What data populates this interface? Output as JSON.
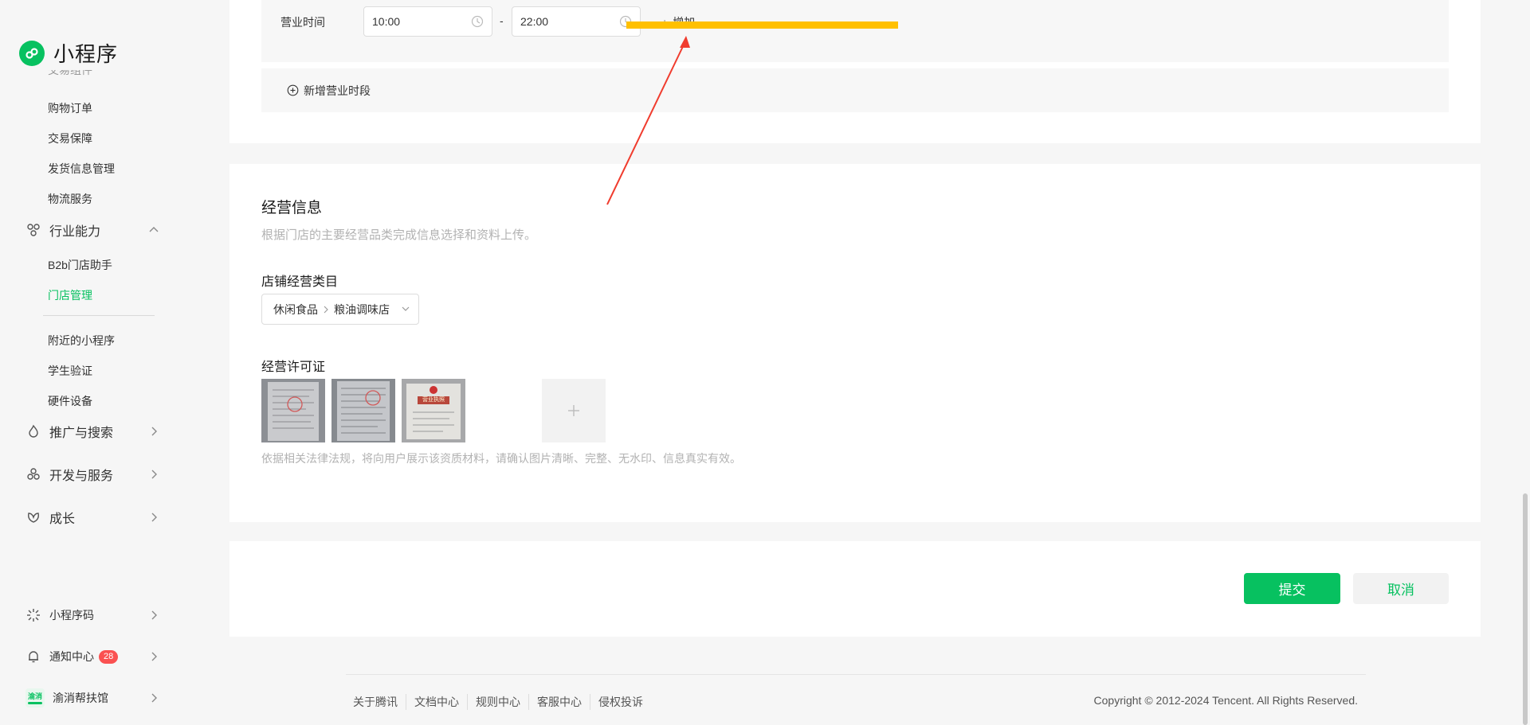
{
  "app": {
    "title": "小程序"
  },
  "sidebar": {
    "clipped_item": "交易组件",
    "items_trade": [
      "购物订单",
      "交易保障",
      "发货信息管理",
      "物流服务"
    ],
    "industry": {
      "label": "行业能力",
      "items": [
        "B2b门店助手",
        "门店管理",
        "附近的小程序",
        "学生验证",
        "硬件设备"
      ]
    },
    "groups": [
      "推广与搜索",
      "开发与服务",
      "成长"
    ],
    "bottom": {
      "qrcode": "小程序码",
      "notify": "通知中心",
      "notify_badge": "28",
      "account": "渝消帮扶馆",
      "account_icon_text": "渝消"
    }
  },
  "hours": {
    "label": "营业时间",
    "start": "10:00",
    "end": "22:00",
    "dash": "-",
    "add": "增加",
    "add_period": "新增营业时段"
  },
  "business": {
    "title": "经营信息",
    "desc": "根据门店的主要经营品类完成信息选择和资料上传。",
    "category_label": "店铺经营类目",
    "category_level1": "休闲食品",
    "category_level2": "粮油调味店",
    "license_label": "经营许可证",
    "license_stamp_text": "营业执照",
    "hint": "依据相关法律法规，将向用户展示该资质材料，请确认图片清晰、完整、无水印、信息真实有效。"
  },
  "actions": {
    "submit": "提交",
    "cancel": "取消"
  },
  "footer": {
    "links": [
      "关于腾讯",
      "文档中心",
      "规则中心",
      "客服中心",
      "侵权投诉"
    ],
    "copyright": "Copyright © 2012-2024 Tencent. All Rights Reserved."
  },
  "colors": {
    "brand": "#07c160",
    "annotation_arrow": "#f03c2e",
    "annotation_bar": "#ffc000",
    "badge": "#fa5151"
  }
}
